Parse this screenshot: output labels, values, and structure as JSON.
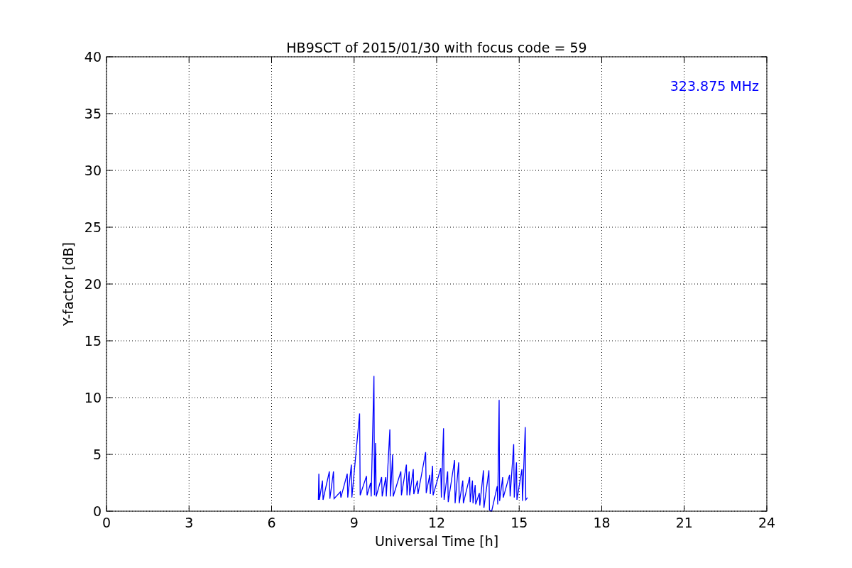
{
  "chart_data": {
    "type": "line",
    "title": "HB9SCT of 2015/01/30 with focus code = 59",
    "xlabel": "Universal Time [h]",
    "ylabel": "Y-factor [dB]",
    "grid": true,
    "xlim": [
      0,
      24
    ],
    "ylim": [
      0,
      40
    ],
    "xticks": [
      0,
      3,
      6,
      9,
      12,
      15,
      18,
      21,
      24
    ],
    "yticks": [
      0,
      5,
      10,
      15,
      20,
      25,
      30,
      35,
      40
    ],
    "x": [
      7.7,
      7.72,
      7.74,
      7.85,
      7.87,
      8.1,
      8.12,
      8.25,
      8.27,
      8.5,
      8.52,
      8.75,
      8.77,
      8.9,
      8.92,
      9.2,
      9.22,
      9.45,
      9.47,
      9.6,
      9.62,
      9.72,
      9.74,
      9.78,
      9.8,
      10.0,
      10.02,
      10.15,
      10.17,
      10.3,
      10.32,
      10.4,
      10.42,
      10.7,
      10.72,
      10.9,
      10.92,
      11.0,
      11.02,
      11.15,
      11.17,
      11.3,
      11.32,
      11.6,
      11.62,
      11.75,
      11.77,
      11.85,
      11.87,
      12.15,
      12.17,
      12.25,
      12.27,
      12.4,
      12.42,
      12.65,
      12.67,
      12.8,
      12.82,
      12.95,
      12.97,
      13.2,
      13.22,
      13.3,
      13.32,
      13.4,
      13.42,
      13.55,
      13.57,
      13.7,
      13.72,
      13.9,
      13.92,
      14.0,
      14.2,
      14.22,
      14.27,
      14.29,
      14.4,
      14.42,
      14.65,
      14.67,
      14.8,
      14.82,
      14.9,
      14.92,
      15.1,
      15.12,
      15.22,
      15.24,
      15.3
    ],
    "series": [
      {
        "name": "323.875 MHz",
        "color": "#0000ff",
        "values": [
          1.0,
          3.3,
          1.0,
          2.7,
          1.0,
          3.5,
          1.1,
          3.5,
          1.1,
          1.7,
          1.2,
          3.3,
          1.2,
          4.1,
          1.2,
          8.6,
          1.4,
          3.1,
          1.4,
          2.5,
          1.3,
          11.9,
          1.4,
          6.0,
          1.3,
          3.0,
          1.3,
          3.0,
          1.3,
          7.2,
          1.3,
          5.0,
          1.3,
          3.5,
          1.4,
          4.1,
          1.4,
          3.5,
          1.4,
          3.7,
          1.5,
          2.7,
          1.5,
          5.2,
          1.6,
          3.2,
          1.5,
          4.0,
          1.4,
          3.8,
          1.2,
          7.3,
          1.0,
          3.5,
          0.8,
          4.5,
          0.7,
          4.3,
          0.7,
          2.7,
          0.7,
          3.0,
          0.8,
          2.7,
          0.7,
          2.3,
          0.6,
          1.6,
          0.5,
          3.6,
          0.3,
          3.6,
          0.1,
          0.0,
          2.2,
          0.6,
          9.8,
          0.9,
          3.0,
          1.2,
          3.2,
          1.3,
          5.9,
          1.2,
          4.3,
          1.0,
          3.7,
          0.9,
          7.4,
          1.0,
          1.2
        ]
      }
    ]
  }
}
